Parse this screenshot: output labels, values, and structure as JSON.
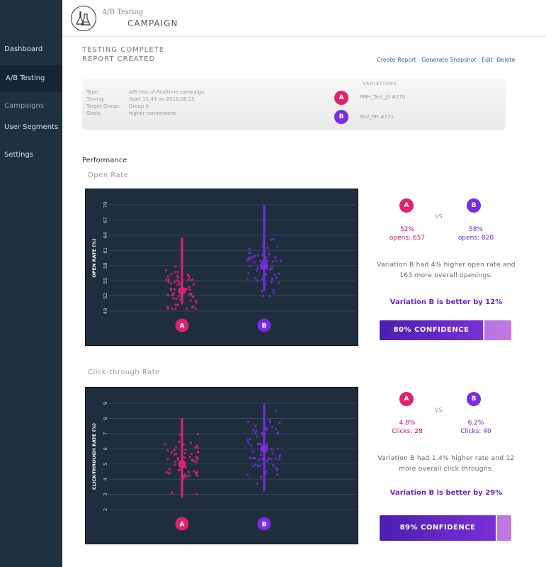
{
  "sidebar": {
    "items": [
      {
        "label": "Dashboard"
      },
      {
        "label": "A/B Testing"
      },
      {
        "label": "Campaigns"
      },
      {
        "label": "User Segments"
      },
      {
        "label": "Settings"
      }
    ]
  },
  "header": {
    "app_name": "A/B Testing",
    "page_name": "CAMPAIGN",
    "logo_icon": "flask-icon"
  },
  "status": {
    "line1": "TESTING COMPLETE",
    "line2": "REPORT CREATED"
  },
  "actions": {
    "create": "Create Report",
    "snapshot": "Generate Snapshot",
    "edit": "Edit",
    "delete": "Delete"
  },
  "info": {
    "type_label": "Type:",
    "type_value": "A/B test of Realtime campaign",
    "timing_label": "Timing:",
    "timing_value": "Start 11.49 on 2016.08.15",
    "target_label": "Target Group:",
    "target_value": "Group A",
    "goals_label": "Goals:",
    "goals_value": "higher conversions",
    "variations_heading": "VARIATIONS",
    "var_a_letter": "A",
    "var_a_name": "PMH_Test_JS #270",
    "var_b_letter": "B",
    "var_b_name": "Test_PH #271"
  },
  "colors": {
    "a": "#e0226e",
    "b": "#7a2de0",
    "dark": "#1e2e3d"
  },
  "performance": {
    "title": "Performance"
  },
  "open_rate": {
    "title": "Open Rate",
    "a_letter": "A",
    "b_letter": "B",
    "vs": "VS",
    "a_pct": "52%",
    "a_count": "opens: 657",
    "b_pct": "58%",
    "b_count": "opens: 820",
    "summary": "Variation B had 4% higher open rate and 163 more overall openings.",
    "better": "Variation B is better by 12%",
    "confidence_label": "80% CONFIDENCE",
    "confidence": 0.8
  },
  "ctr": {
    "title": "Click-through Rate",
    "a_letter": "A",
    "b_letter": "B",
    "vs": "VS",
    "a_pct": "4.8%",
    "a_count": "Clicks: 28",
    "b_pct": "6.2%",
    "b_count": "Clicks: 40",
    "summary": "Variation B had 1.4% higher rate and 12 more overall click throughs.",
    "better": "Variation B is better by 29%",
    "confidence_label": "89% CONFIDENCE",
    "confidence": 0.89
  },
  "chart_data": [
    {
      "type": "scatter",
      "ylabel": "OPEN RATE (%)",
      "yticks": [
        49,
        52,
        55,
        58,
        61,
        64,
        67,
        70
      ],
      "ylim": [
        49,
        70
      ],
      "categories": [
        "A",
        "B"
      ],
      "series": [
        {
          "name": "A",
          "mean": 53,
          "range": [
            50.5,
            63.5
          ]
        },
        {
          "name": "B",
          "mean": 58,
          "range": [
            53,
            70
          ]
        }
      ]
    },
    {
      "type": "scatter",
      "ylabel": "CLICK-THROUGH RATE (%)",
      "yticks": [
        2,
        3,
        4,
        5,
        6,
        7,
        8,
        9
      ],
      "ylim": [
        2,
        9
      ],
      "categories": [
        "A",
        "B"
      ],
      "series": [
        {
          "name": "A",
          "mean": 5,
          "range": [
            2.8,
            8
          ]
        },
        {
          "name": "B",
          "mean": 6,
          "range": [
            3.2,
            9
          ]
        }
      ]
    }
  ]
}
